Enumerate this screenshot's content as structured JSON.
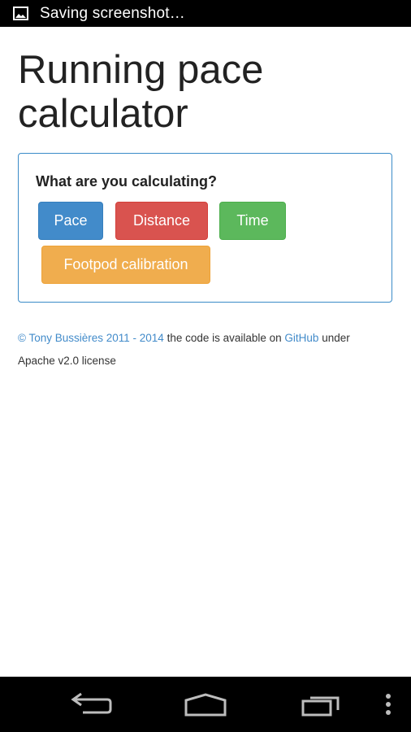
{
  "status_bar": {
    "notification_icon": "image-icon",
    "text": "Saving screenshot…"
  },
  "page": {
    "title": "Running pace calculator"
  },
  "calculator": {
    "question": "What are you calculating?",
    "buttons": {
      "pace": "Pace",
      "distance": "Distance",
      "time": "Time",
      "footpod": "Footpod calibration"
    }
  },
  "footer": {
    "copyright_link": "© Tony Bussières 2011 - 2014",
    "text_middle": " the code is available on ",
    "github_link": "GitHub",
    "text_end": " under Apache v2.0 license"
  },
  "nav_bar": {
    "back_icon": "back-icon",
    "home_icon": "home-icon",
    "recents_icon": "recents-icon",
    "menu_icon": "overflow-menu-icon"
  },
  "colors": {
    "primary": "#428bca",
    "danger": "#d9534f",
    "success": "#5cb85c",
    "warning": "#f0ad4e",
    "panel_border": "#3a8bc8"
  }
}
